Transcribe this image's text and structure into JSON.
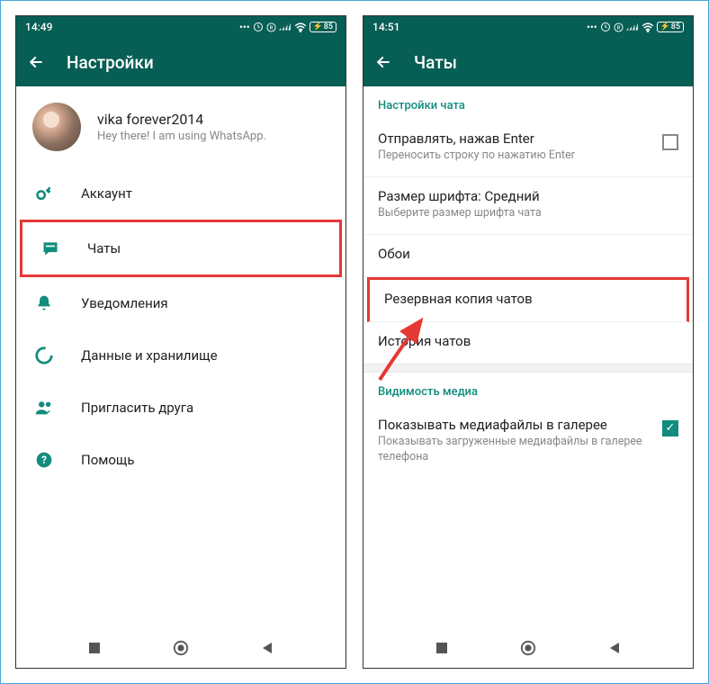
{
  "left": {
    "status_time": "14:49",
    "header_title": "Настройки",
    "profile": {
      "name": "vika forever2014",
      "status": "Hey there! I am using WhatsApp."
    },
    "menu": {
      "account": "Аккаунт",
      "chats": "Чаты",
      "notifications": "Уведомления",
      "data": "Данные и хранилище",
      "invite": "Пригласить друга",
      "help": "Помощь"
    }
  },
  "right": {
    "status_time": "14:51",
    "header_title": "Чаты",
    "section_chat_settings": "Настройки чата",
    "enter_send": {
      "title": "Отправлять, нажав Enter",
      "subtitle": "Переносить строку по нажатию Enter",
      "checked": false
    },
    "font_size": {
      "title": "Размер шрифта: Средний",
      "subtitle": "Выберите размер шрифта чата"
    },
    "wallpaper": "Обои",
    "backup": "Резервная копия чатов",
    "history": "История чатов",
    "section_media": "Видимость медиа",
    "media_visibility": {
      "title": "Показывать медиафайлы в галерее",
      "subtitle": "Показывать загруженные медиафайлы в галерее телефона",
      "checked": true
    }
  },
  "battery": "85"
}
